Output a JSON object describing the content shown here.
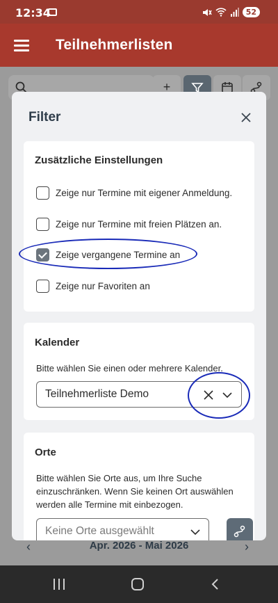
{
  "status_bar": {
    "time": "12:34",
    "battery": "52"
  },
  "app_bar": {
    "title": "Teilnehmerlisten"
  },
  "background": {
    "date_range": "Apr. 2026  -  Mai 2026"
  },
  "modal": {
    "title": "Filter",
    "settings": {
      "title": "Zusätzliche Einstellungen",
      "options": [
        {
          "label": "Zeige nur Termine mit eigener Anmeldung.",
          "checked": false
        },
        {
          "label": "Zeige nur Termine mit freien Plätzen an.",
          "checked": false
        },
        {
          "label": "Zeige vergangene Termine an",
          "checked": true
        },
        {
          "label": "Zeige nur Favoriten an",
          "checked": false
        }
      ]
    },
    "calendar": {
      "title": "Kalender",
      "help": "Bitte wählen Sie einen oder mehrere Kalender.",
      "selected": "Teilnehmerliste Demo"
    },
    "locations": {
      "title": "Orte",
      "help": "Bitte wählen Sie Orte aus, um Ihre Suche einzuschränken. Wenn Sie keinen Ort auswählen werden alle Termine mit einbezogen.",
      "placeholder": "Keine Orte ausgewählt"
    }
  },
  "colors": {
    "app_bar": "#a8392d",
    "annotation": "#1a2bb8",
    "checkbox_checked": "#6c757d"
  }
}
